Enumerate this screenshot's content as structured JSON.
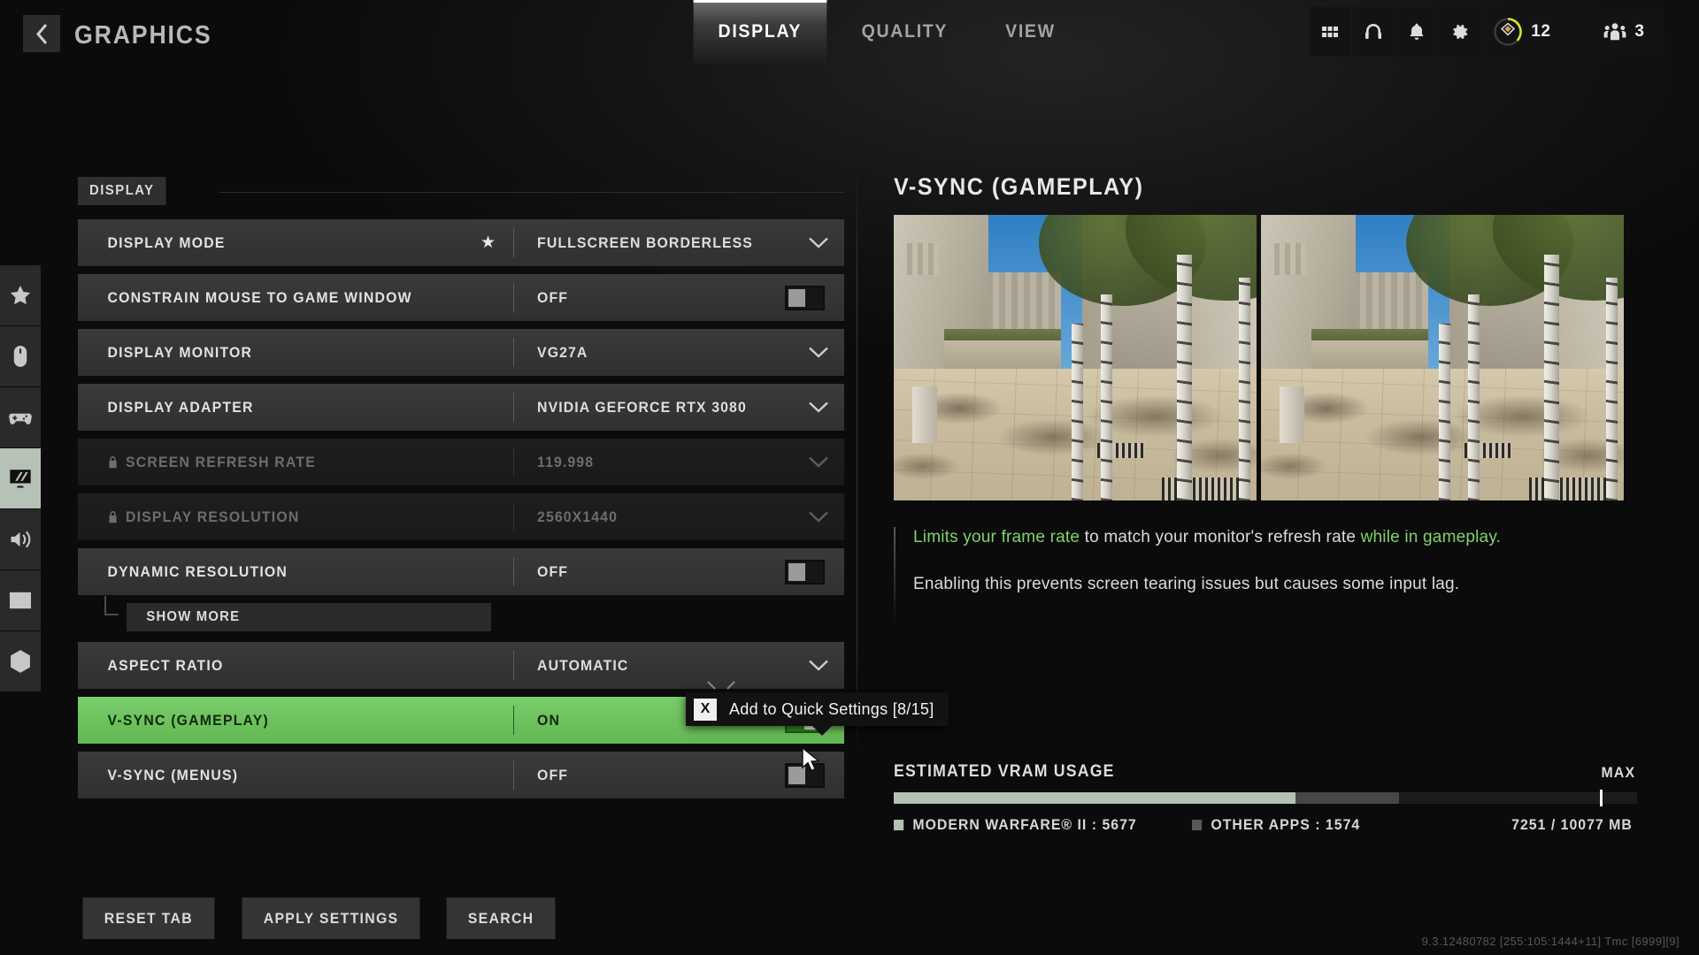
{
  "header": {
    "back_icon": "chevron-left-icon",
    "title": "GRAPHICS",
    "tabs": [
      {
        "label": "DISPLAY",
        "active": true
      },
      {
        "label": "QUALITY",
        "active": false
      },
      {
        "label": "VIEW",
        "active": false
      }
    ],
    "system_icons": [
      "grid-icon",
      "headset-icon",
      "bell-icon",
      "gear-icon"
    ],
    "rank": {
      "icon": "rank-badge-icon",
      "value": "12"
    },
    "party": {
      "icon": "party-icon",
      "value": "3"
    }
  },
  "rail": {
    "items": [
      {
        "icon": "star-icon",
        "name": "favorites",
        "active": false
      },
      {
        "icon": "mouse-icon",
        "name": "mouse-keyboard",
        "active": false
      },
      {
        "icon": "gamepad-icon",
        "name": "controller",
        "active": false
      },
      {
        "icon": "monitor-icon",
        "name": "graphics",
        "active": true
      },
      {
        "icon": "speaker-icon",
        "name": "audio",
        "active": false
      },
      {
        "icon": "interface-icon",
        "name": "interface",
        "active": false
      },
      {
        "icon": "telemetry-icon",
        "name": "telemetry",
        "active": false
      }
    ]
  },
  "settings": {
    "section_label": "DISPLAY",
    "rows": [
      {
        "label": "DISPLAY MODE",
        "value": "FULLSCREEN BORDERLESS",
        "control": "dropdown",
        "starred": true,
        "disabled": false,
        "selected": false,
        "locked": false
      },
      {
        "label": "CONSTRAIN MOUSE TO GAME WINDOW",
        "value": "OFF",
        "control": "toggle",
        "toggle_on": false,
        "starred": false,
        "disabled": false,
        "selected": false,
        "locked": false
      },
      {
        "label": "DISPLAY MONITOR",
        "value": "VG27A",
        "control": "dropdown",
        "starred": false,
        "disabled": false,
        "selected": false,
        "locked": false
      },
      {
        "label": "DISPLAY ADAPTER",
        "value": "NVIDIA GEFORCE RTX 3080",
        "control": "dropdown",
        "starred": false,
        "disabled": false,
        "selected": false,
        "locked": false
      },
      {
        "label": "SCREEN REFRESH RATE",
        "value": "119.998",
        "control": "dropdown",
        "starred": false,
        "disabled": true,
        "selected": false,
        "locked": true
      },
      {
        "label": "DISPLAY RESOLUTION",
        "value": "2560X1440",
        "control": "dropdown",
        "starred": false,
        "disabled": true,
        "selected": false,
        "locked": true
      },
      {
        "label": "DYNAMIC RESOLUTION",
        "value": "OFF",
        "control": "toggle",
        "toggle_on": false,
        "starred": false,
        "disabled": false,
        "selected": false,
        "locked": false
      }
    ],
    "show_more_label": "SHOW MORE",
    "rows_after": [
      {
        "label": "ASPECT RATIO",
        "value": "AUTOMATIC",
        "control": "dropdown",
        "starred": false,
        "disabled": false,
        "selected": false,
        "locked": false
      },
      {
        "label": "V-SYNC (GAMEPLAY)",
        "value": "ON",
        "control": "toggle",
        "toggle_on": true,
        "starred": false,
        "disabled": false,
        "selected": true,
        "locked": false
      },
      {
        "label": "V-SYNC (MENUS)",
        "value": "OFF",
        "control": "toggle",
        "toggle_on": false,
        "starred": false,
        "disabled": false,
        "selected": false,
        "locked": false
      }
    ]
  },
  "tooltip": {
    "key": "X",
    "text": "Add to Quick Settings [8/15]"
  },
  "detail": {
    "title": "V-SYNC (GAMEPLAY)",
    "preview_count": 2,
    "description_1_parts": [
      {
        "text": "Limits your frame rate",
        "highlight": true
      },
      {
        "text": " to match your monitor's refresh rate ",
        "highlight": false
      },
      {
        "text": "while in gameplay.",
        "highlight": true
      }
    ],
    "description_2": "Enabling this prevents screen tearing issues but causes some input lag."
  },
  "vram": {
    "title": "ESTIMATED VRAM USAGE",
    "max_label": "MAX",
    "game_label": "MODERN WARFARE® II : 5677",
    "other_label": "OTHER APPS : 1574",
    "total_label": "7251 / 10077 MB",
    "game_mb": 5677,
    "other_mb": 1574,
    "used_mb": 7251,
    "capacity_mb": 10077,
    "game_pct": 54,
    "other_pct": 14,
    "max_marker_pct": 95
  },
  "footer": {
    "buttons": [
      {
        "label": "RESET TAB"
      },
      {
        "label": "APPLY SETTINGS"
      },
      {
        "label": "SEARCH"
      }
    ],
    "version": "9.3.12480782 [255:105:1444+11] Tmc [6999][9]"
  },
  "colors": {
    "accent_green": "#79cc6a",
    "highlight_text_green": "#7fd36a",
    "rail_active_bg": "#b6c2b6",
    "vram_game": "#b4c1b4",
    "vram_other": "#474747"
  }
}
